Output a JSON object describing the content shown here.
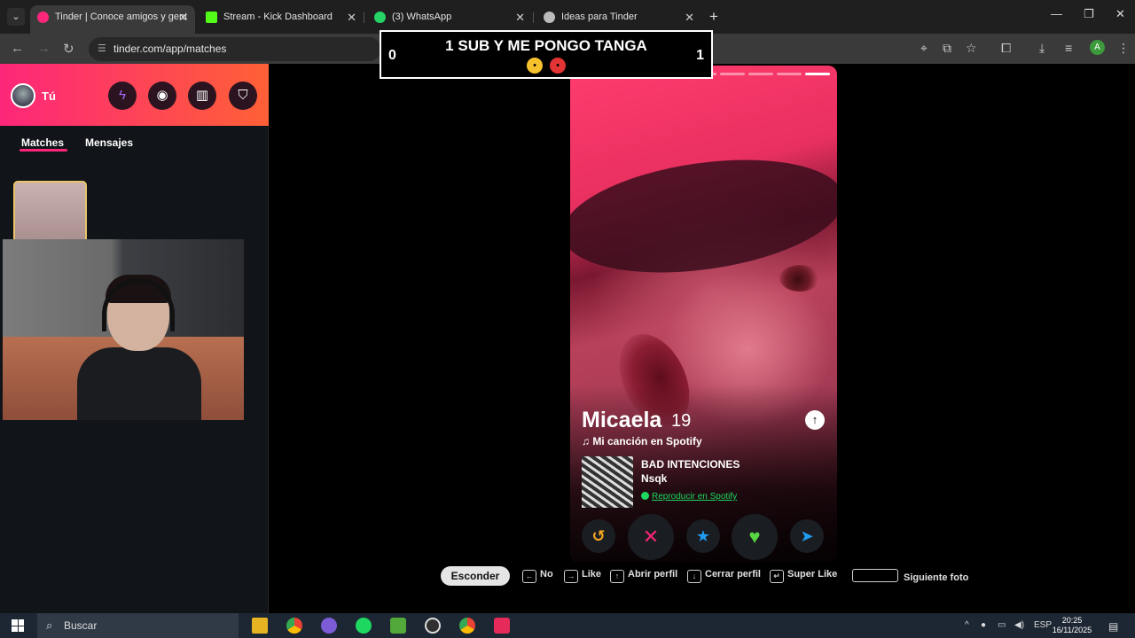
{
  "browser": {
    "tabs": [
      {
        "label": "Tinder | Conoce amigos y gent",
        "active": true,
        "color": "#fd267a"
      },
      {
        "label": "Stream - Kick Dashboard",
        "active": false,
        "color": "#53fc18"
      },
      {
        "label": "(3) WhatsApp",
        "active": false,
        "color": "#25d366"
      },
      {
        "label": "Ideas para Tinder",
        "active": false,
        "color": "#bbbbbb"
      }
    ],
    "url": "tinder.com/app/matches",
    "profile_initial": "A"
  },
  "overlay": {
    "title": "1 SUB Y ME PONGO TANGA",
    "left_count": "0",
    "right_count": "1"
  },
  "sidebar": {
    "user_label": "Tú",
    "tabs": [
      {
        "label": "Matches",
        "active": true
      },
      {
        "label": "Mensajes",
        "active": false
      }
    ],
    "header_icons": [
      "boost-icon",
      "explore-icon",
      "passport-icon",
      "safety-shield-icon"
    ]
  },
  "profile": {
    "name": "Micaela",
    "age": "19",
    "spotify_heading": "Mi canción en Spotify",
    "song_title": "BAD INTENCIONES",
    "song_artist": "Nsqk",
    "spotify_link": "Reproducir en Spotify",
    "photo_count": 9,
    "photo_index": 9,
    "actions": [
      {
        "name": "rewind",
        "glyph": "↺",
        "color": "#f5a623"
      },
      {
        "name": "nope",
        "glyph": "✕",
        "color": "#fd267a"
      },
      {
        "name": "super-like",
        "glyph": "★",
        "color": "#1f9cf0"
      },
      {
        "name": "like",
        "glyph": "♥",
        "color": "#58d643"
      },
      {
        "name": "boost",
        "glyph": "➤",
        "color": "#1f9cf0"
      }
    ]
  },
  "hints": {
    "hide": "Esconder",
    "no": "No",
    "like": "Like",
    "open_profile": "Abrir perfil",
    "close_profile": "Cerrar perfil",
    "super_like": "Super Like",
    "next_photo": "Siguiente foto"
  },
  "taskbar": {
    "search_placeholder": "Buscar",
    "language": "ESP",
    "time": "20:25",
    "date": "16/11/2025"
  },
  "colors": {
    "tinder_gradient_start": "#fd267a",
    "tinder_gradient_end": "#ff6036",
    "spotify_green": "#1ed760"
  }
}
